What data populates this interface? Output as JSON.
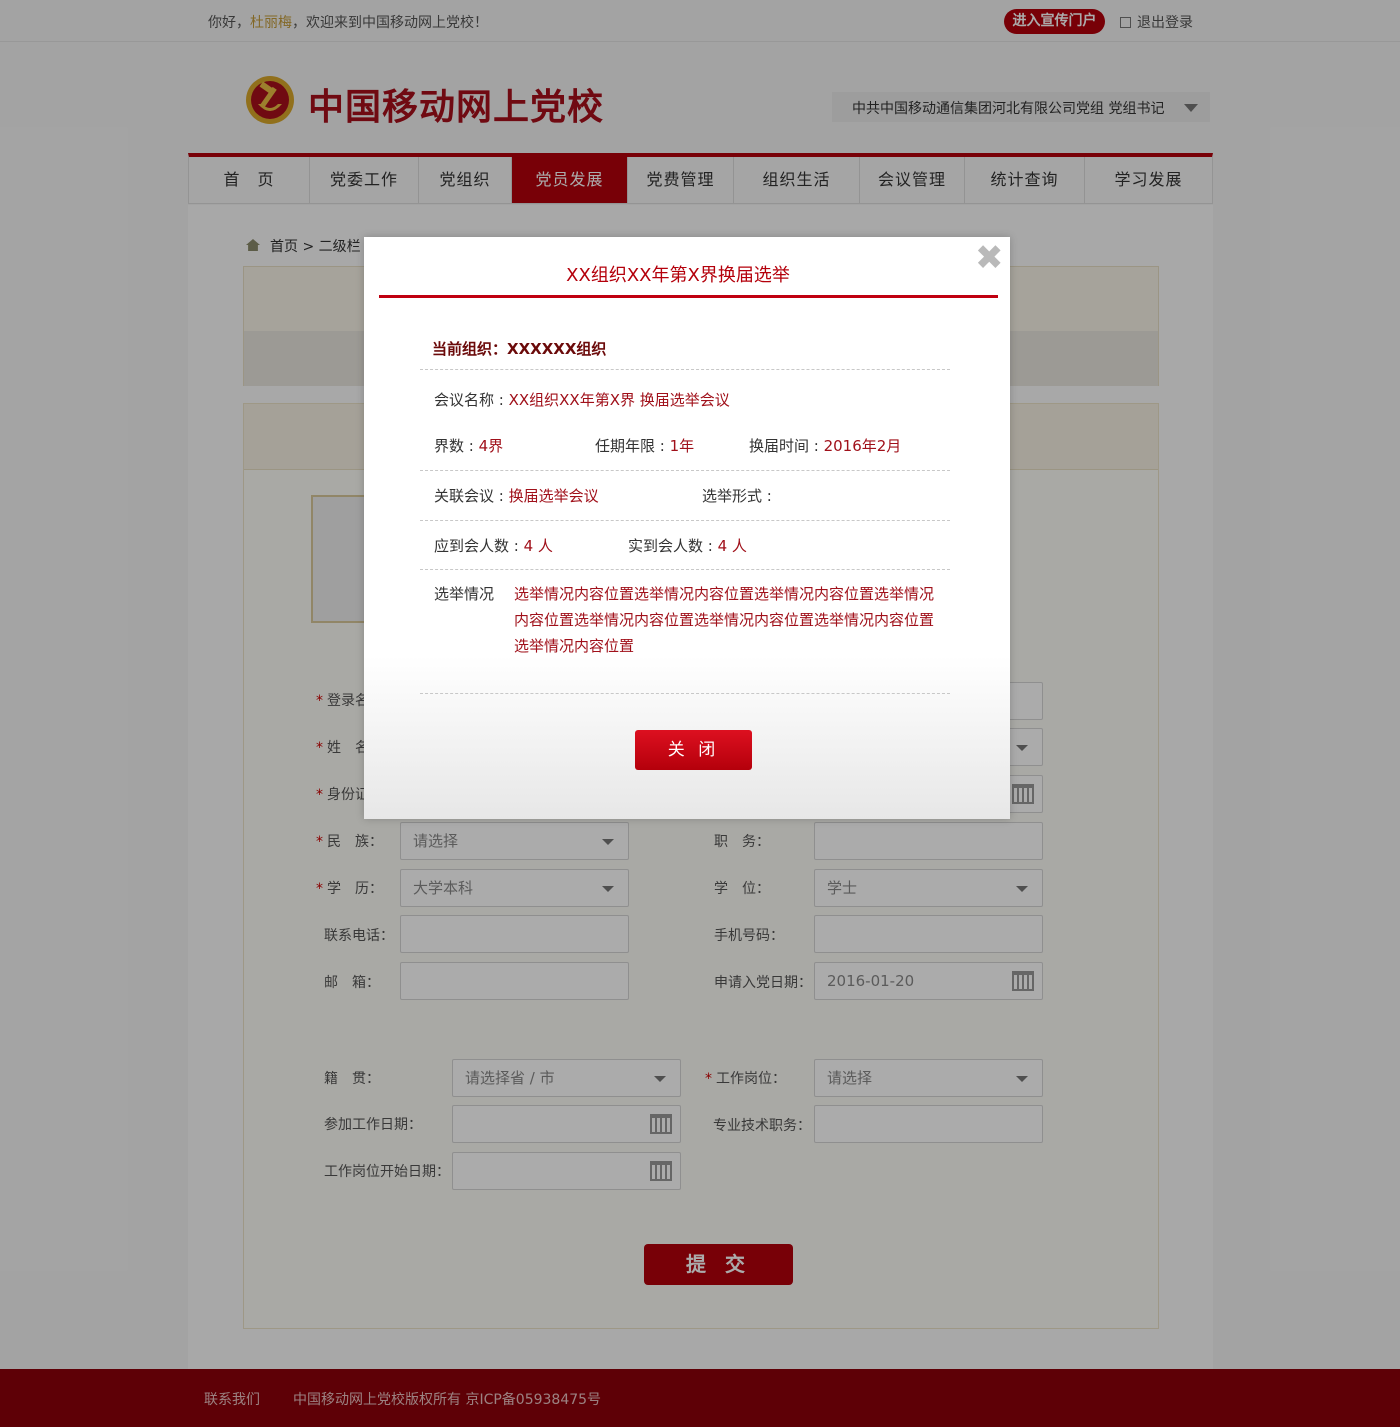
{
  "topbar": {
    "greeting_prefix": "你好，",
    "user_name": "杜丽梅",
    "greeting_suffix": "，欢迎来到中国移动网上党校！",
    "portal_button": "进入宣传门户",
    "logout": "退出登录"
  },
  "header": {
    "site_title": "中国移动网上党校",
    "org_selector": "中共中国移动通信集团河北有限公司党组   党组书记"
  },
  "nav": {
    "items": [
      "首　页",
      "党委工作",
      "党组织",
      "党员发展",
      "党费管理",
      "组织生活",
      "会议管理",
      "统计查询",
      "学习发展"
    ],
    "active_index": 3
  },
  "breadcrumb": {
    "home": "首页",
    "sep": " > ",
    "current": "二级栏"
  },
  "form": {
    "fields": [
      {
        "label": "登录名",
        "required": true
      },
      {
        "label": "姓　名",
        "required": true
      },
      {
        "label": "身份证",
        "required": true
      },
      {
        "label": "民　族：",
        "required": true,
        "value": "请选择"
      },
      {
        "label": "职　务：",
        "required": false,
        "value": ""
      },
      {
        "label": "学　历：",
        "required": true,
        "value": "大学本科"
      },
      {
        "label": "学　位：",
        "required": false,
        "value": "学士"
      },
      {
        "label": "联系电话：",
        "required": false,
        "value": ""
      },
      {
        "label": "手机号码：",
        "required": false,
        "value": ""
      },
      {
        "label": "邮　箱：",
        "required": false,
        "value": ""
      },
      {
        "label": "申请入党日期：",
        "required": false,
        "value": "2016-01-20"
      },
      {
        "label": "籍　贯：",
        "required": false,
        "value": "请选择省 / 市"
      },
      {
        "label": "工作岗位：",
        "required": true,
        "value": "请选择"
      },
      {
        "label": "参加工作日期：",
        "required": false,
        "value": ""
      },
      {
        "label": "专业技术职务：",
        "required": false,
        "value": ""
      },
      {
        "label": "工作岗位开始日期：",
        "required": false,
        "value": ""
      }
    ],
    "submit": "提 交"
  },
  "modal": {
    "title": "XX组织XX年第X界换届选举",
    "current_org_label": "当前组织：",
    "current_org_value": "XXXXXX组织",
    "meeting_name_label": "会议名称 : ",
    "meeting_name_value": "XX组织XX年第X界 换届选举会议",
    "term_count_label": "界数 : ",
    "term_count_value": "4界",
    "term_years_label": "任期年限 : ",
    "term_years_value": "1年",
    "election_time_label": "换届时间 : ",
    "election_time_value": "2016年2月",
    "related_meeting_label": "关联会议 : ",
    "related_meeting_value": "换届选举会议",
    "election_form_label": "选举形式 :",
    "expected_label": "应到会人数 : ",
    "expected_value": "4 人",
    "actual_label": "实到会人数 : ",
    "actual_value": "4 人",
    "situation_label": "选举情况",
    "situation_value": "选举情况内容位置选举情况内容位置选举情况内容位置选举情况内容位置选举情况内容位置选举情况内容位置选举情况内容位置选举情况内容位置",
    "close_button": "关 闭"
  },
  "footer": {
    "contact": "联系我们",
    "copyright": "中国移动网上党校版权所有  京ICP备05938475号"
  },
  "colors": {
    "brand_red": "#b4000b",
    "footer_red": "#8c0009",
    "accent_gold": "#c39b3a"
  }
}
